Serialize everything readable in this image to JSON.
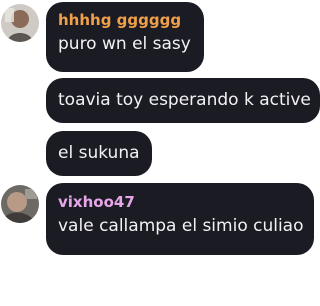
{
  "messages": [
    {
      "sender": "hhhhg gggggg",
      "sender_color": "#f0a04a",
      "text": "puro wn el sasy",
      "avatar": "user-avatar-1"
    },
    {
      "text": "toavia toy esperando k active"
    },
    {
      "text": "el sukuna"
    },
    {
      "sender": "vixhoo47",
      "sender_color": "#e6a6e8",
      "text": "vale callampa el simio culiao",
      "avatar": "user-avatar-2"
    }
  ]
}
